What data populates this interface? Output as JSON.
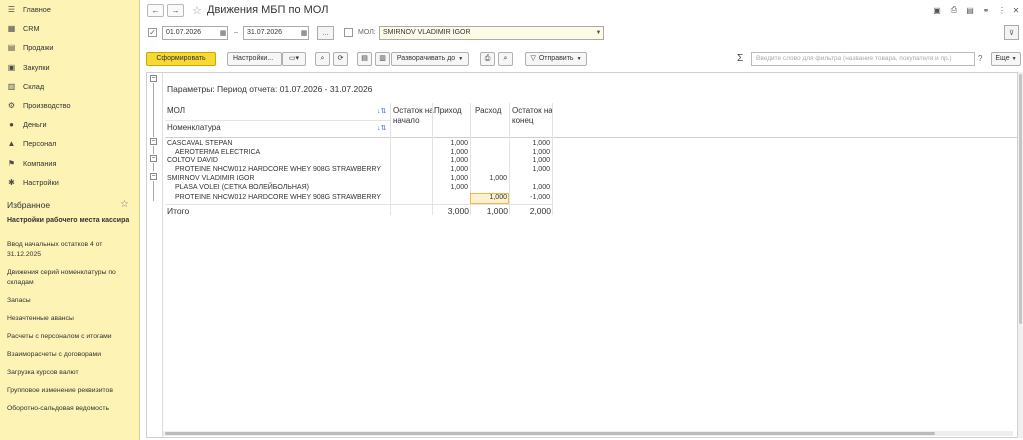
{
  "sidebar": {
    "items": [
      {
        "label": "Главное",
        "icon": "menu-icon"
      },
      {
        "label": "CRM",
        "icon": "crm-icon"
      },
      {
        "label": "Продажи",
        "icon": "sales-icon"
      },
      {
        "label": "Закупки",
        "icon": "purchases-icon"
      },
      {
        "label": "Склад",
        "icon": "warehouse-icon"
      },
      {
        "label": "Производство",
        "icon": "production-icon"
      },
      {
        "label": "Деньги",
        "icon": "money-icon"
      },
      {
        "label": "Персонал",
        "icon": "personnel-icon"
      },
      {
        "label": "Компания",
        "icon": "company-icon"
      },
      {
        "label": "Настройки",
        "icon": "settings-icon"
      }
    ],
    "favorites_title": "Избранное",
    "favorites_current": "Настройки рабочего места кассира",
    "favorites": [
      "Ввод начальных остатков 4 от 31.12.2025",
      "Движения серий номенклатуры по складам",
      "Запасы",
      "Незачтенные авансы",
      "Расчеты с персоналом с итогами",
      "Взаиморасчеты с договорами",
      "Загрузка курсов валют",
      "Групповое изменение реквизитов",
      "Оборотно-сальдовая ведомость"
    ]
  },
  "header": {
    "back": "←",
    "forward": "→",
    "title": "Движения МБП по МОЛ"
  },
  "filters": {
    "date_from": "01.07.2026",
    "date_to": "31.07.2026",
    "dash": "–",
    "more_label": "...",
    "mol_label": "МОЛ:",
    "mol_value": "SMIRNOV VLADIMIR IGOR"
  },
  "toolbar": {
    "generate": "Сформировать",
    "settings": "Настройки...",
    "expand": "Разворачивать до",
    "send": "Отправить",
    "sigma": "Σ",
    "search_placeholder": "Введите слово для фильтра (название товара, покупателя и пр.)",
    "help": "?",
    "more": "Еще"
  },
  "report": {
    "params": "Параметры:   Период отчета: 01.07.2026 - 31.07.2026",
    "col_mol": "МОЛ",
    "col_nomenclature": "Номенклатура",
    "col_start": "Остаток на начало",
    "col_in": "Приход",
    "col_out": "Расход",
    "col_end": "Остаток на конец",
    "rows": [
      {
        "name": "CASCAVAL STEPAN",
        "start": "",
        "in": "1,000",
        "out": "",
        "end": "1,000",
        "level": 0
      },
      {
        "name": "AEROTERMA ELECTRICA",
        "start": "",
        "in": "1,000",
        "out": "",
        "end": "1,000",
        "level": 1
      },
      {
        "name": "COLTOV DAVID",
        "start": "",
        "in": "1,000",
        "out": "",
        "end": "1,000",
        "level": 0
      },
      {
        "name": "PROTEINE NHCW012 HARDCORE WHEY 908G STRAWBERRY",
        "start": "",
        "in": "1,000",
        "out": "",
        "end": "1,000",
        "level": 1
      },
      {
        "name": "SMIRNOV VLADIMIR IGOR",
        "start": "",
        "in": "1,000",
        "out": "1,000",
        "end": "",
        "level": 0
      },
      {
        "name": "PLASA VOLEI (СЕТКА ВОЛЕЙБОЛЬНАЯ)",
        "start": "",
        "in": "1,000",
        "out": "",
        "end": "1,000",
        "level": 1
      },
      {
        "name": "PROTEINE NHCW012 HARDCORE WHEY 908G STRAWBERRY",
        "start": "",
        "in": "",
        "out": "1,000",
        "end": "-1,000",
        "level": 1
      }
    ],
    "total_label": "Итого",
    "total_in": "3,000",
    "total_out": "1,000",
    "total_end": "2,000"
  }
}
